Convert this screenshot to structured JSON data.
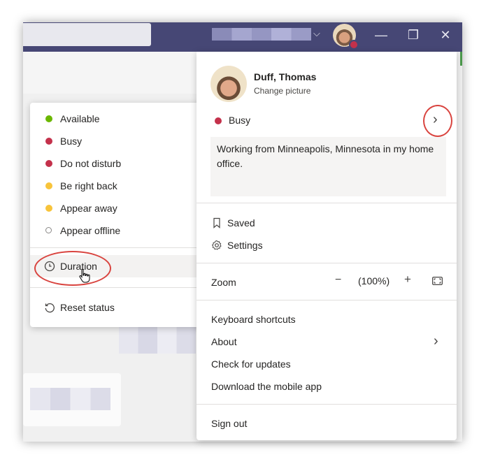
{
  "colors": {
    "titlebar": "#464775",
    "available": "#6bb700",
    "busy": "#c4314b",
    "away": "#f8c43b",
    "offline": "#8a8886",
    "annotation": "#d9443f"
  },
  "titlebar": {
    "chevron_icon": "chevron-down-icon",
    "minimize_glyph": "—",
    "restore_glyph": "❐",
    "close_glyph": "✕"
  },
  "status_menu": {
    "items": [
      {
        "label": "Available",
        "color": "#6bb700",
        "icon": "check-dot-icon"
      },
      {
        "label": "Busy",
        "color": "#c4314b",
        "icon": "busy-dot-icon"
      },
      {
        "label": "Do not disturb",
        "color": "#c4314b",
        "icon": "dnd-dot-icon"
      },
      {
        "label": "Be right back",
        "color": "#f8c43b",
        "icon": "clock-dot-icon"
      },
      {
        "label": "Appear away",
        "color": "#f8c43b",
        "icon": "clock-dot-icon"
      },
      {
        "label": "Appear offline",
        "color": "#8a8886",
        "icon": "offline-dot-icon"
      }
    ],
    "duration_label": "Duration",
    "reset_label": "Reset status"
  },
  "profile": {
    "name": "Duff, Thomas",
    "change_picture": "Change picture",
    "status_label": "Busy",
    "status_message": "Working from Minneapolis, Minnesota in my home office.",
    "saved_label": "Saved",
    "settings_label": "Settings",
    "zoom_label": "Zoom",
    "zoom_minus": "−",
    "zoom_value": "(100%)",
    "zoom_plus": "+",
    "keyboard_shortcuts": "Keyboard shortcuts",
    "about": "About",
    "check_updates": "Check for updates",
    "download_app": "Download the mobile app",
    "sign_out": "Sign out"
  }
}
